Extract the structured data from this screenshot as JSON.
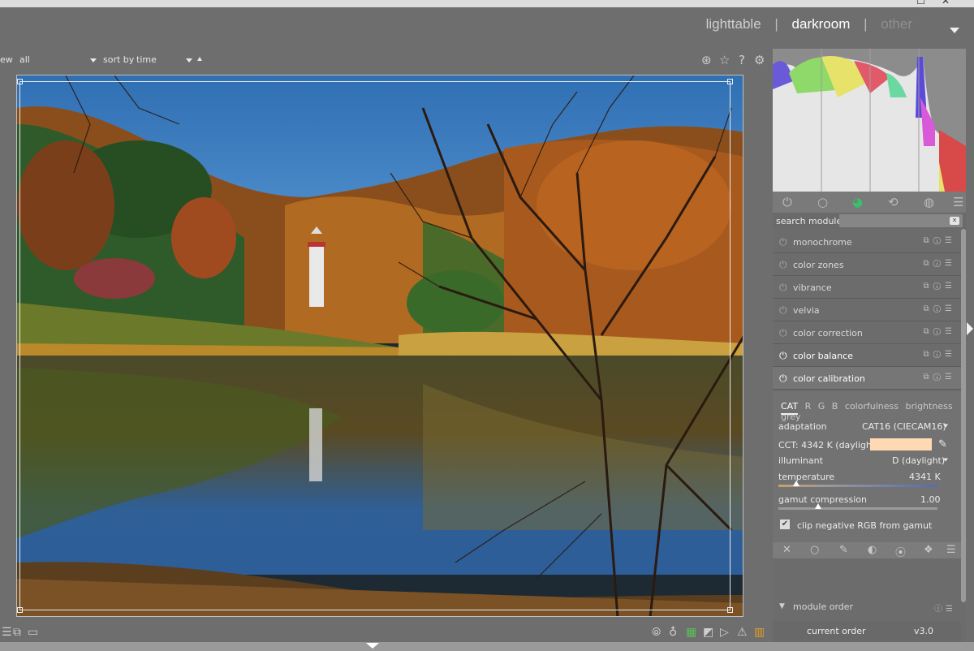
{
  "window": {
    "controls": [
      "☐",
      "✕"
    ]
  },
  "header": {
    "views": [
      {
        "label": "lighttable",
        "state": "inactive"
      },
      {
        "label": "darkroom",
        "state": "active"
      },
      {
        "label": "other",
        "state": "dim"
      }
    ],
    "separator": "|"
  },
  "filter_bar": {
    "view_label": "ew",
    "view_value": "all",
    "sort_label": "sort by",
    "sort_value": "time"
  },
  "search": {
    "label": "search module",
    "placeholder": ""
  },
  "modules": [
    {
      "name": "monochrome",
      "on": false
    },
    {
      "name": "color zones",
      "on": false
    },
    {
      "name": "vibrance",
      "on": false
    },
    {
      "name": "velvia",
      "on": false
    },
    {
      "name": "color correction",
      "on": false
    },
    {
      "name": "color balance",
      "on": true
    },
    {
      "name": "color calibration",
      "on": true,
      "expanded": true
    }
  ],
  "color_calibration": {
    "tabs": [
      "CAT",
      "R",
      "G",
      "B",
      "colorfulness",
      "brightness",
      "grey"
    ],
    "active_tab": "CAT",
    "adaptation_label": "adaptation",
    "adaptation_value": "CAT16 (CIECAM16)",
    "cct_text": "CCT: 4342 K (daylight)",
    "cct_swatch_color": "#ffd9b3",
    "illuminant_label": "illuminant",
    "illuminant_value": "D (daylight)",
    "temperature_label": "temperature",
    "temperature_value": "4341 K",
    "temperature_position": 0.11,
    "gamut_label": "gamut compression",
    "gamut_value": "1.00",
    "gamut_position": 0.25,
    "clip_label": "clip negative RGB from gamut",
    "clip_checked": true
  },
  "module_order": {
    "label": "module order",
    "current_label": "current order",
    "current_value": "v3.0"
  },
  "colors": {
    "accent_white": "#ffffff",
    "panel_bg": "#6c6c6c"
  }
}
